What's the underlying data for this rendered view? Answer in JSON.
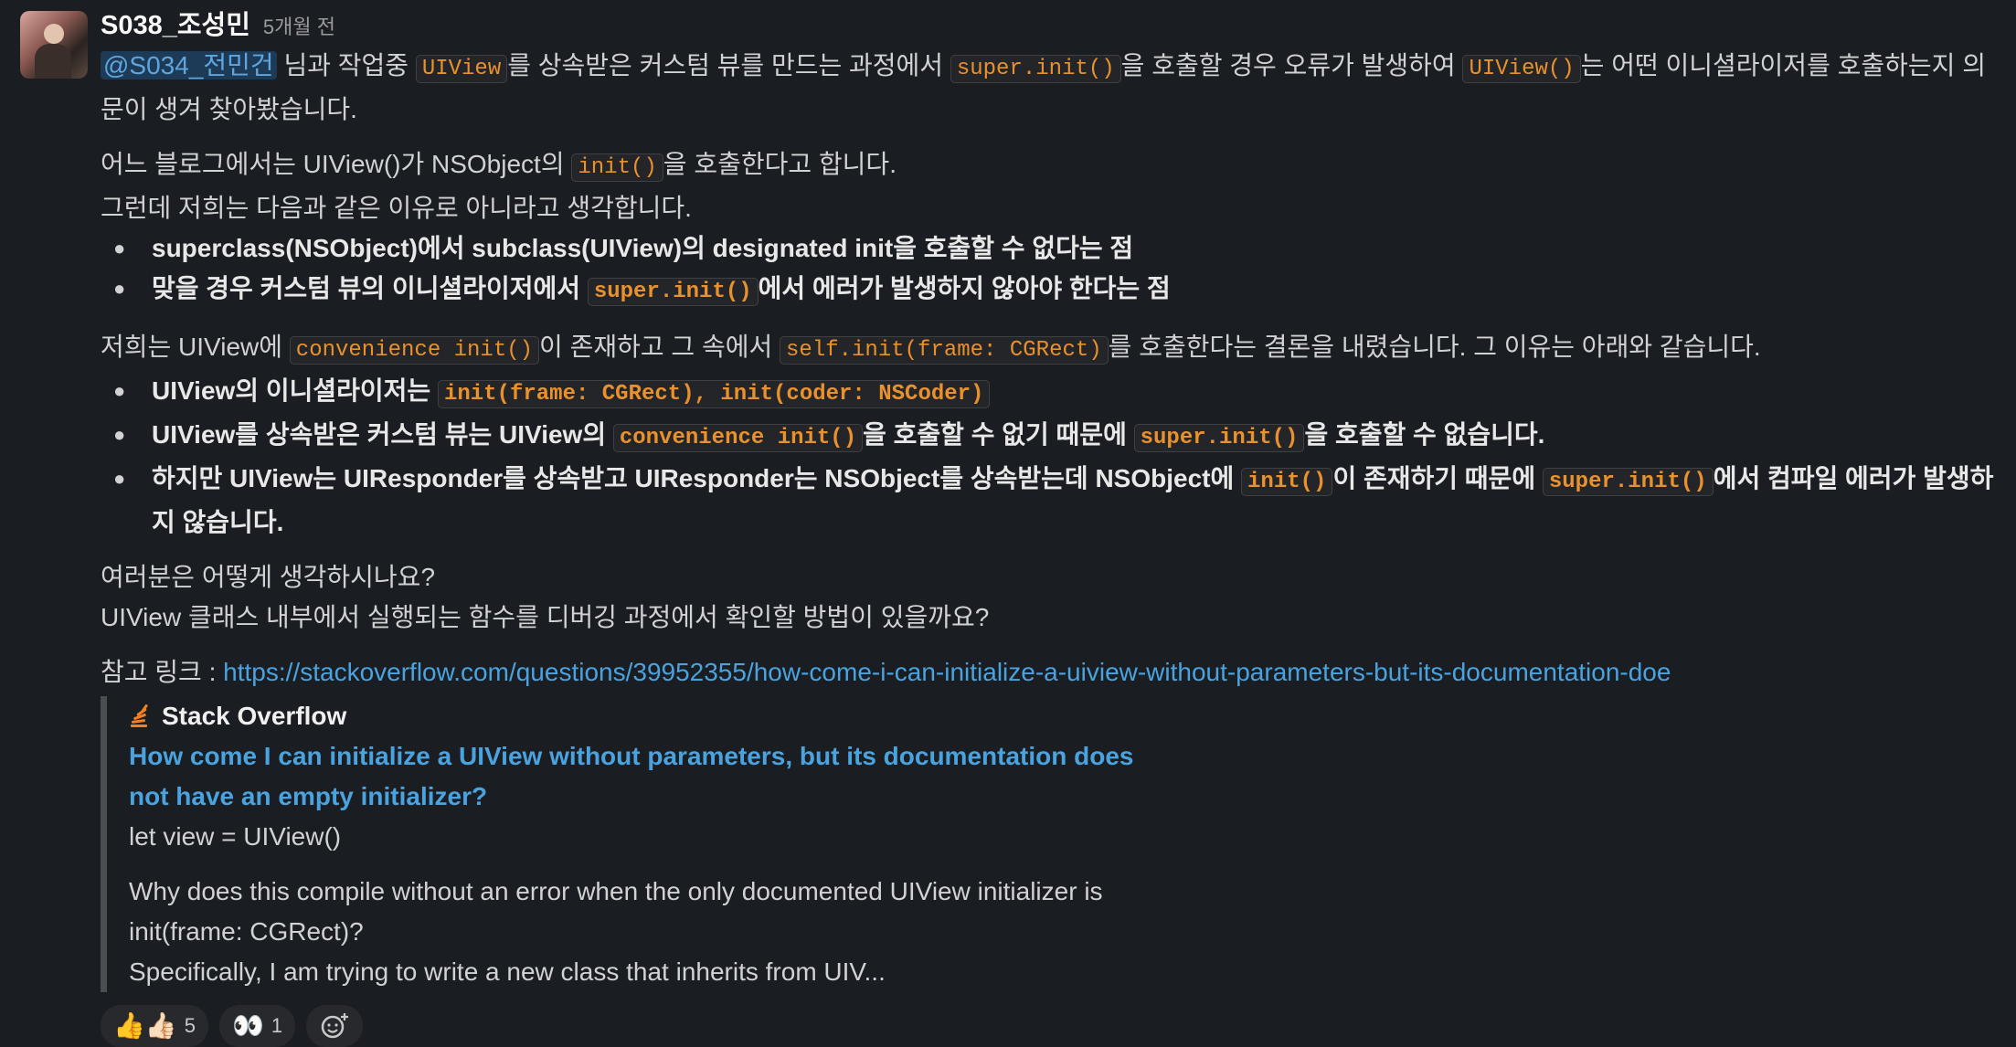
{
  "message": {
    "username": "S038_조성민",
    "time": "5개월 전",
    "intro": {
      "mention": "@S034_전민건",
      "t1": " 님과 작업중 ",
      "c1": "UIView",
      "t2": "를 상속받은 커스텀 뷰를 만드는 과정에서 ",
      "c2": "super.init()",
      "t3": "을 호출할 경우 오류가 발생하여 ",
      "c3": "UIView()",
      "t4": "는 어떤 이니셜라이저를 호출하는지 의문이 생겨 찾아봤습니다."
    },
    "blog": {
      "t1": "어느 블로그에서는 UIView()가 NSObject의 ",
      "c1": "init()",
      "t2": "을 호출한다고 합니다.",
      "line2": "그런데 저희는 다음과 같은 이유로 아니라고 생각합니다."
    },
    "reasons1": {
      "item1": "superclass(NSObject)에서 subclass(UIView)의 designated init을 호출할 수 없다는 점",
      "item2_t1": "맞을 경우 커스텀 뷰의 이니셜라이저에서 ",
      "item2_c1": "super.init()",
      "item2_t2": "에서 에러가 발생하지 않아야 한다는 점"
    },
    "conclusion": {
      "t1": "저희는 UIView에 ",
      "c1": "convenience init()",
      "t2": "이 존재하고 그 속에서 ",
      "c2": "self.init(frame: CGRect)",
      "t3": "를 호출한다는 결론을 내렸습니다. 그 이유는 아래와 같습니다."
    },
    "reasons2": {
      "item1_t1": "UIView의 이니셜라이저는 ",
      "item1_c1": "init(frame: CGRect), init(coder: NSCoder)",
      "item2_t1": "UIView를 상속받은 커스텀 뷰는 UIView의 ",
      "item2_c1": "convenience init()",
      "item2_t2": "을 호출할 수 없기 때문에 ",
      "item2_c2": "super.init()",
      "item2_t3": "을 호출할 수 없습니다.",
      "item3_t1": "하지만 UIView는 UIResponder를 상속받고 UIResponder는 NSObject를 상속받는데 NSObject에 ",
      "item3_c1": "init()",
      "item3_t2": "이 존재하기 때문에 ",
      "item3_c2": "super.init()",
      "item3_t3": "에서 컴파일 에러가 발생하지 않습니다."
    },
    "questions": {
      "q1": "여러분은 어떻게 생각하시나요?",
      "q2": "UIView 클래스 내부에서 실행되는 함수를 디버깅 과정에서 확인할 방법이 있을까요?"
    },
    "reference": {
      "label": "참고 링크 : ",
      "url": "https://stackoverflow.com/questions/39952355/how-come-i-can-initialize-a-uiview-without-parameters-but-its-documentation-doe"
    }
  },
  "unfurl": {
    "site": "Stack Overflow",
    "icon": "stackoverflow-icon",
    "title": "How come I can initialize a UIView without parameters, but its documentation does not have an empty initializer?",
    "snippet1": "let view = UIView()",
    "snippet2": "Why does this compile without an error when the only documented UIView initializer is init(frame: CGRect)?",
    "snippet3": "Specifically, I am trying to write a new class that inherits from UIV..."
  },
  "reactions": [
    {
      "emoji": "👍👍🏻",
      "count": "5"
    },
    {
      "emoji": "👀",
      "count": "1"
    }
  ],
  "colors": {
    "background": "#1a1d21",
    "code": "#e8912d",
    "link": "#4aa3df",
    "mention_bg": "#1d3a57"
  }
}
